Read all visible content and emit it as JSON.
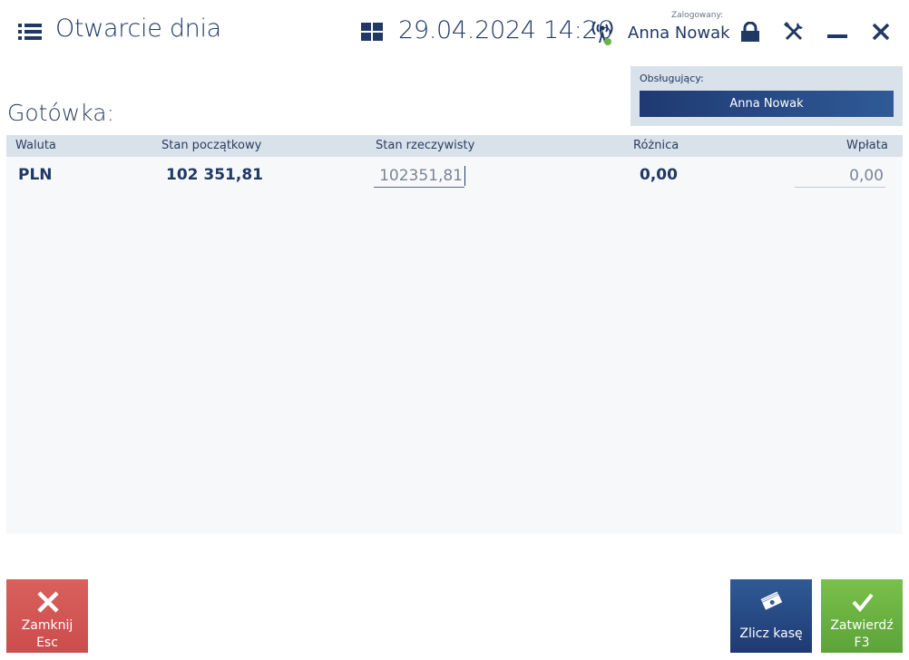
{
  "header": {
    "title": "Otwarcie dnia",
    "datetime": "29.04.2024 14:26",
    "logged_label": "Zalogowany:",
    "logged_user": "Anna Nowak",
    "icons": [
      "menu-icon",
      "grid-icon",
      "signal-icon",
      "lock-icon",
      "tools-icon",
      "minimize-icon",
      "close-icon"
    ]
  },
  "operator": {
    "label": "Obsługujący:",
    "name": "Anna Nowak"
  },
  "section": {
    "title": "Gotówka:"
  },
  "table": {
    "columns": [
      "Waluta",
      "Stan początkowy",
      "Stan rzeczywisty",
      "Różnica",
      "Wpłata"
    ],
    "rows": [
      {
        "currency": "PLN",
        "initial": "102 351,81",
        "actual": "102351,81",
        "difference": "0,00",
        "deposit": "0,00"
      }
    ]
  },
  "buttons": {
    "close": {
      "label": "Zamknij",
      "key": "Esc"
    },
    "count": {
      "label": "Zlicz kasę"
    },
    "confirm": {
      "label": "Zatwierdź",
      "key": "F3"
    }
  },
  "colors": {
    "accent": "#1f3a72",
    "close": "#d9605c",
    "confirm": "#6cb443",
    "status_online": "#6cb443"
  }
}
